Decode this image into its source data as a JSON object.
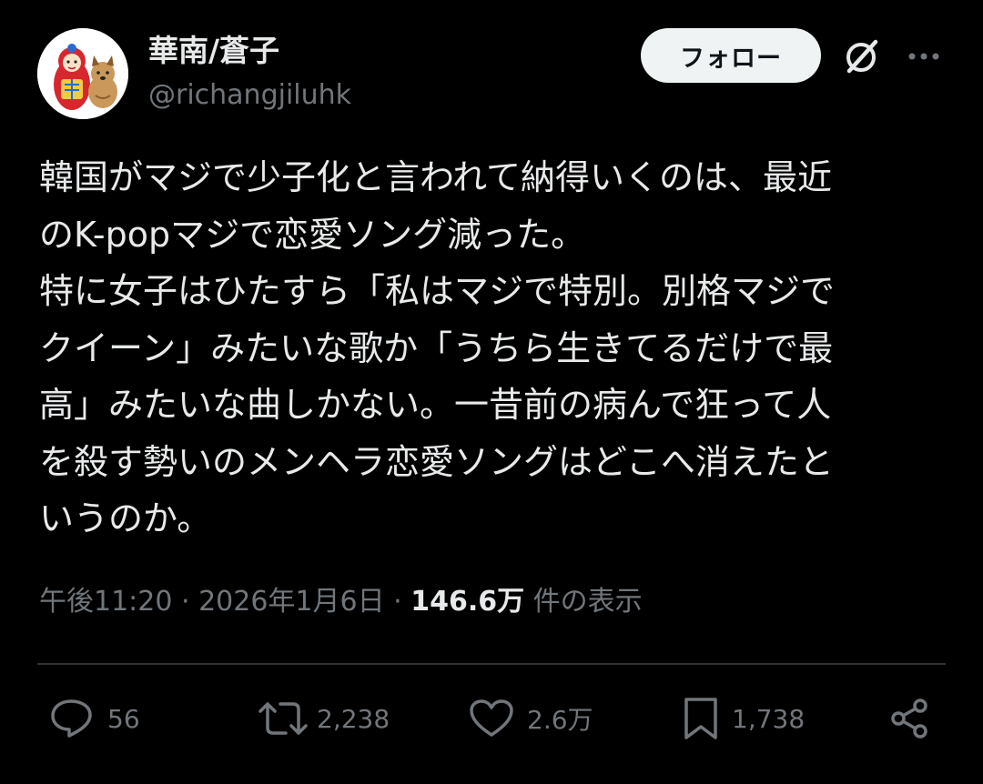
{
  "user": {
    "display_name": "華南/蒼子",
    "handle": "@richangjiluhk",
    "avatar_icon": "avatar-doll-and-dog-icon"
  },
  "header": {
    "follow_label": "フォロー",
    "grok_icon": "grok-icon",
    "more_icon": "more-options-icon"
  },
  "tweet": {
    "lines": [
      "韓国がマジで少子化と言われて納得いくのは、最近",
      "のK-popマジで恋愛ソング減った。",
      "特に女子はひたすら「私はマジで特別。別格マジで",
      "クイーン」みたいな歌か「うちら生きてるだけで最",
      "高」みたいな曲しかない。一昔前の病んで狂って人",
      "を殺す勢いのメンヘラ恋愛ソングはどこへ消えたと",
      "いうのか。"
    ]
  },
  "meta": {
    "time": "午後11:20",
    "separator1": " · ",
    "date": "2026年1月6日",
    "separator2": " · ",
    "views_count": "146.6万",
    "views_label": " 件の表示"
  },
  "actions": {
    "reply_count": "56",
    "repost_count": "2,238",
    "like_count": "2.6万",
    "bookmark_count": "1,738"
  },
  "colors": {
    "background": "#000000",
    "text_primary": "#e7e9ea",
    "text_secondary": "#71767b",
    "divider": "#2f3336",
    "follow_button_bg": "#eff3f4"
  }
}
